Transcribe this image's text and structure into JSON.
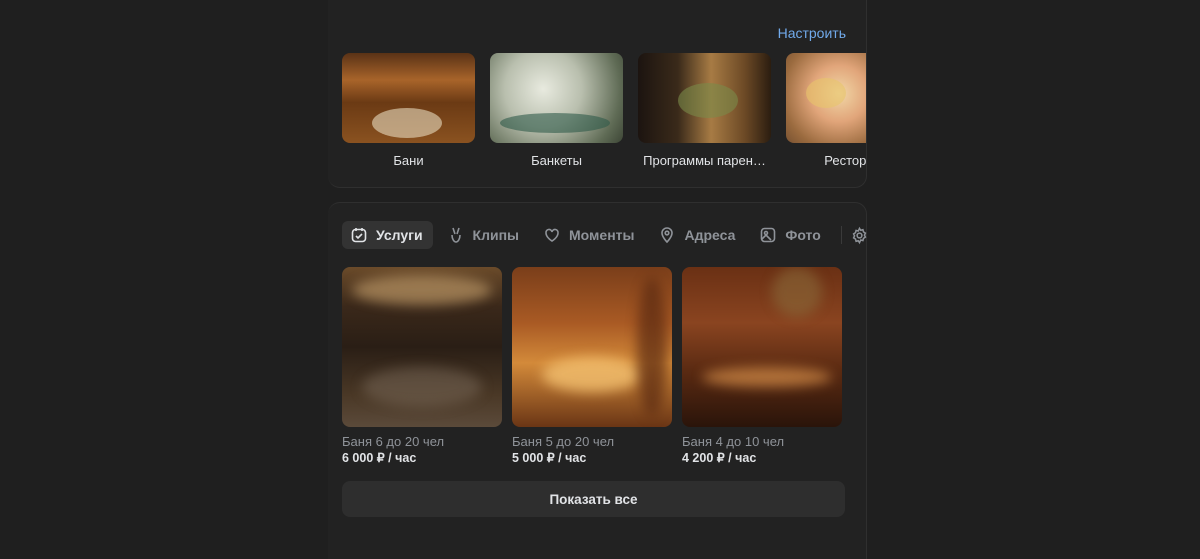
{
  "header": {
    "configure_label": "Настроить"
  },
  "categories": [
    {
      "label": "Бани"
    },
    {
      "label": "Банкеты"
    },
    {
      "label": "Программы парен…"
    },
    {
      "label": "Ресторан"
    }
  ],
  "tabs": [
    {
      "label": "Услуги",
      "icon": "check-calendar-icon",
      "active": true
    },
    {
      "label": "Клипы",
      "icon": "clip-hand-icon"
    },
    {
      "label": "Моменты",
      "icon": "moments-icon"
    },
    {
      "label": "Адреса",
      "icon": "location-pin-icon"
    },
    {
      "label": "Фото",
      "icon": "photo-icon"
    }
  ],
  "services": [
    {
      "name": "Баня 6 до 20 чел",
      "price": "6 000 ₽ / час"
    },
    {
      "name": "Баня 5 до 20 чел",
      "price": "5 000 ₽ / час"
    },
    {
      "name": "Баня 4 до 10 чел",
      "price": "4 200 ₽ / час"
    }
  ],
  "show_all_label": "Показать все",
  "colors": {
    "background": "#1f1f1f",
    "card": "#222222",
    "accent_link": "#71aaeb",
    "active_tab_bg": "#333333"
  }
}
